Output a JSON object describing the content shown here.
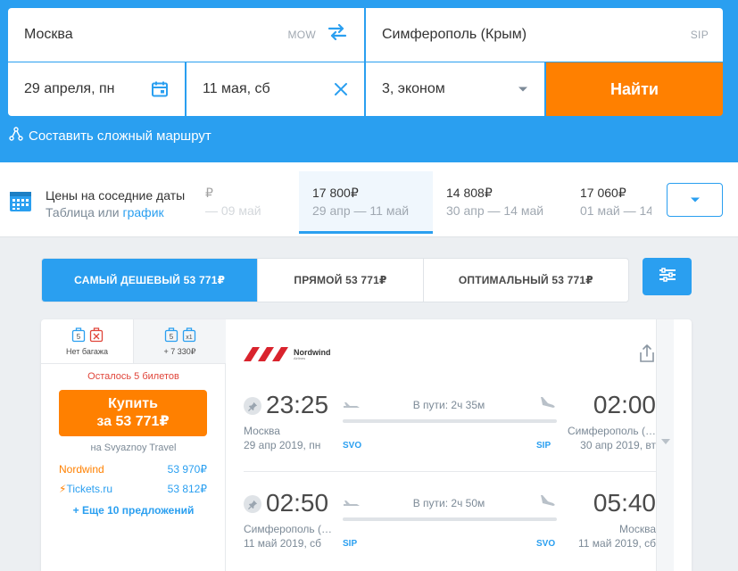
{
  "search": {
    "origin": "Москва",
    "origin_code": "MOW",
    "destination": "Симферополь (Крым)",
    "destination_code": "SIP",
    "depart_date": "29 апреля, пн",
    "return_date": "11 мая, сб",
    "passengers": "3, эконом",
    "search_button": "Найти",
    "complex_route_link": "Составить сложный маршрут"
  },
  "neighbor_dates": {
    "title": "Цены на соседние даты",
    "sub_prefix": "Таблица",
    "sub_or": "или",
    "sub_link": "график",
    "cells": [
      {
        "price": "₽",
        "dates": "— 09 май"
      },
      {
        "price": "17 800₽",
        "dates": "29 апр — 11 май"
      },
      {
        "price": "14 808₽",
        "dates": "30 апр — 14 май"
      },
      {
        "price": "17 060₽",
        "dates": "01 май — 14"
      }
    ]
  },
  "sort_tabs": [
    {
      "label": "САМЫЙ ДЕШЕВЫЙ 53 771₽"
    },
    {
      "label": "ПРЯМОЙ 53 771₽"
    },
    {
      "label": "ОПТИМАЛЬНЫЙ 53 771₽"
    }
  ],
  "ticket": {
    "baggage_tabs": [
      {
        "label": "Нет багажа",
        "bag_number": "5"
      },
      {
        "label": "+ 7 330₽",
        "bag_number": "5",
        "extra": "x1"
      }
    ],
    "tickets_left": "Осталось 5 билетов",
    "buy_line1": "Купить",
    "buy_line2": "за 53 771₽",
    "via": "на Svyaznoy Travel",
    "offers": [
      {
        "name": "Nordwind",
        "price": "53 970₽"
      },
      {
        "name": "Tickets.ru",
        "price": "53 812₽"
      }
    ],
    "more_offers": "+ Еще 10 предложений",
    "airline_name": "Nordwind",
    "airline_sub": "Airlines",
    "segments": [
      {
        "dep_time": "23:25",
        "arr_time": "02:00",
        "dep_city": "Москва",
        "arr_city": "Симферополь (…",
        "dep_date": "29 апр 2019, пн",
        "arr_date": "30 апр 2019, вт",
        "duration": "В пути: 2ч 35м",
        "dep_airport": "SVO",
        "arr_airport": "SIP"
      },
      {
        "dep_time": "02:50",
        "arr_time": "05:40",
        "dep_city": "Симферополь (…",
        "arr_city": "Москва",
        "dep_date": "11 май 2019, сб",
        "arr_date": "11 май 2019, сб",
        "duration": "В пути: 2ч 50м",
        "dep_airport": "SIP",
        "arr_airport": "SVO"
      }
    ]
  },
  "colors": {
    "brand_blue": "#2a9ff0",
    "accent_orange": "#ff8000",
    "warning_red": "#e0453a",
    "airline_red": "#d9232d"
  }
}
